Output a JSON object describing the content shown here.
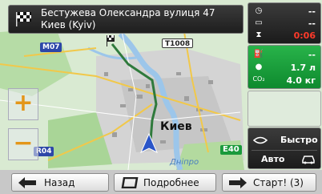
{
  "destination": {
    "line1": "Бестужева Олександра вулиця 47",
    "line2": "Киев (Kyiv)"
  },
  "info_panel": {
    "eta_value": "--",
    "dist_value": "--",
    "time_remaining": "0:06",
    "eco_top_value": "--",
    "fuel_value": "1.7 л",
    "co2_label": "CO₂",
    "co2_value": "4.0 кг",
    "route_type": "Быстро",
    "vehicle": "Авто"
  },
  "map": {
    "city_label": "Киев",
    "river_label": "Дніпро",
    "road_labels": {
      "m07": "M07",
      "t1008": "T1008",
      "r04": "R04",
      "e40": "E40"
    },
    "zoom_in": "+",
    "zoom_out": "−"
  },
  "toolbar": {
    "back_label": "Назад",
    "details_label": "Подробнее",
    "start_label": "Старт! (3)"
  },
  "colors": {
    "route": "#2f7a3c",
    "eco_panel": "#1ea23f",
    "zoom": "#e39619",
    "alert_red": "#ff3a2a"
  }
}
